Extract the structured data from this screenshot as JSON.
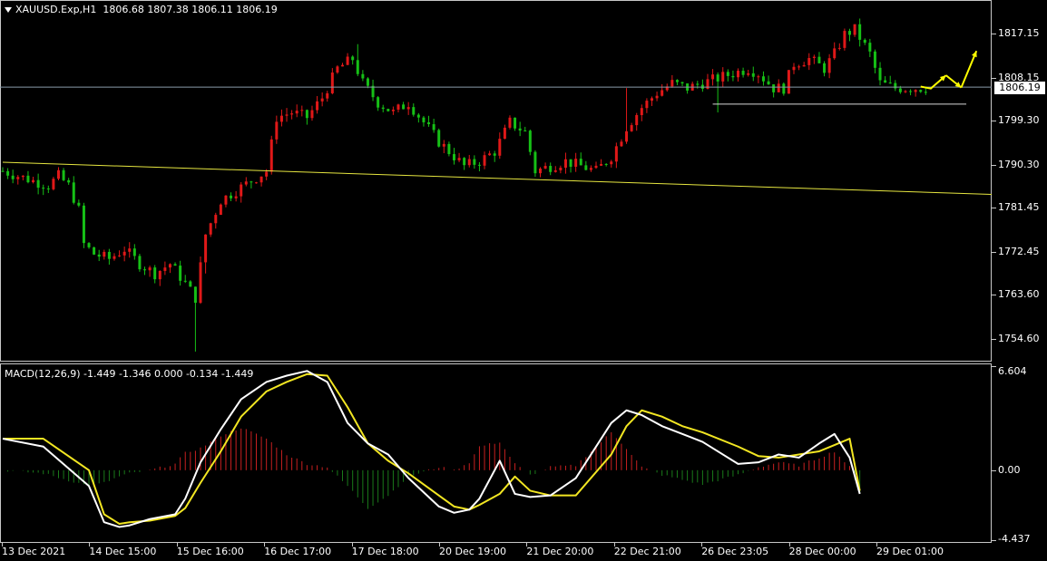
{
  "header": {
    "symbol": "XAUUSD.Exp,H1",
    "ohlc": "1806.68 1807.38 1806.11 1806.19",
    "macd_label": "MACD(12,26,9) -1.449 -1.346 0.000 -0.134 -1.449"
  },
  "current_price": "1806.19",
  "colors": {
    "background": "#000000",
    "bull": "#e01818",
    "bear": "#16c016",
    "trendline": "#e6e640",
    "macd_line": "#ffffff",
    "signal_line": "#f2e622",
    "histogram_pos": "#c82020",
    "histogram_neg": "#1a7a1a",
    "arrows": "#ffff00",
    "grid": "#c8c8c8"
  },
  "chart_data": [
    {
      "type": "candlestick",
      "title": "XAUUSD.Exp,H1",
      "ylim": [
        1750.5,
        1823.3
      ],
      "yticks": [
        "1817.15",
        "1808.15",
        "1799.30",
        "1790.30",
        "1781.45",
        "1772.45",
        "1763.60",
        "1754.60"
      ],
      "x_labels": [
        "13 Dec 2021",
        "14 Dec 15:00",
        "15 Dec 16:00",
        "16 Dec 17:00",
        "17 Dec 18:00",
        "20 Dec 19:00",
        "21 Dec 20:00",
        "22 Dec 21:00",
        "26 Dec 23:05",
        "28 Dec 00:00",
        "29 Dec 01:00"
      ],
      "price_path": [
        [
          0,
          1789
        ],
        [
          3,
          1788
        ],
        [
          6,
          1787
        ],
        [
          9,
          1786
        ],
        [
          11,
          1788
        ],
        [
          13,
          1786
        ],
        [
          15,
          1781
        ],
        [
          16,
          1774
        ],
        [
          18,
          1772
        ],
        [
          21,
          1771
        ],
        [
          24,
          1773
        ],
        [
          27,
          1770
        ],
        [
          30,
          1768
        ],
        [
          33,
          1770
        ],
        [
          36,
          1766
        ],
        [
          38,
          1763
        ],
        [
          40,
          1776
        ],
        [
          43,
          1783
        ],
        [
          46,
          1785
        ],
        [
          49,
          1787
        ],
        [
          52,
          1789
        ],
        [
          54,
          1800
        ],
        [
          57,
          1801
        ],
        [
          60,
          1800
        ],
        [
          63,
          1804
        ],
        [
          66,
          1810
        ],
        [
          69,
          1812
        ],
        [
          71,
          1807
        ],
        [
          74,
          1803
        ],
        [
          77,
          1801
        ],
        [
          80,
          1803
        ],
        [
          83,
          1799
        ],
        [
          86,
          1795
        ],
        [
          89,
          1792
        ],
        [
          91,
          1790
        ],
        [
          94,
          1791
        ],
        [
          97,
          1793
        ],
        [
          100,
          1799
        ],
        [
          103,
          1797
        ],
        [
          105,
          1789
        ],
        [
          108,
          1790
        ],
        [
          111,
          1791
        ],
        [
          114,
          1790
        ],
        [
          117,
          1789
        ],
        [
          120,
          1792
        ],
        [
          123,
          1798
        ],
        [
          126,
          1802
        ],
        [
          129,
          1805
        ],
        [
          132,
          1807
        ],
        [
          135,
          1806
        ],
        [
          138,
          1807
        ],
        [
          141,
          1808
        ],
        [
          144,
          1809
        ],
        [
          147,
          1810
        ],
        [
          149,
          1809
        ],
        [
          152,
          1806
        ],
        [
          154,
          1806
        ],
        [
          156,
          1811
        ],
        [
          159,
          1812
        ],
        [
          162,
          1810
        ],
        [
          164,
          1813
        ],
        [
          166,
          1817
        ],
        [
          168,
          1818
        ],
        [
          171,
          1813
        ],
        [
          173,
          1807
        ],
        [
          176,
          1806
        ],
        [
          179,
          1806
        ],
        [
          182,
          1806
        ]
      ],
      "long_wicks": [
        [
          38,
          1752
        ],
        [
          40,
          1768
        ],
        [
          70,
          1815
        ],
        [
          123,
          1806
        ],
        [
          141,
          1801
        ]
      ],
      "level_line": 1806.19,
      "support_line": [
        [
          140,
          1802.7
        ],
        [
          190,
          1802.7
        ]
      ],
      "trendline": [
        [
          0,
          1790.8
        ],
        [
          190,
          1784.2
        ]
      ],
      "projection_arrows": [
        [
          [
            181,
            1806.3
          ],
          [
            183,
            1805.9
          ],
          [
            186,
            1808.6
          ]
        ],
        [
          [
            186,
            1808.6
          ],
          [
            189,
            1806.1
          ]
        ],
        [
          [
            189,
            1806.1
          ],
          [
            192,
            1813.6
          ]
        ]
      ]
    },
    {
      "type": "line",
      "title": "MACD(12,26,9)",
      "ylim": [
        -4.437,
        6.604
      ],
      "yticks": [
        "6.604",
        "0.00",
        "-4.437"
      ],
      "x": [
        0,
        8,
        17,
        20,
        23,
        25,
        29,
        34,
        36,
        39,
        43,
        47,
        52,
        56,
        60,
        64,
        68,
        72,
        76,
        80,
        86,
        89,
        92,
        94,
        98,
        101,
        104,
        108,
        113,
        120,
        123,
        126,
        130,
        134,
        138,
        145,
        149,
        153,
        157,
        161,
        164,
        167,
        169
      ],
      "series": [
        {
          "name": "macd",
          "values": [
            2.0,
            1.5,
            -1.0,
            -3.3,
            -3.6,
            -3.5,
            -3.1,
            -2.8,
            -1.8,
            0.5,
            2.6,
            4.5,
            5.6,
            6.0,
            6.3,
            5.6,
            3.0,
            1.7,
            1.0,
            -0.5,
            -2.3,
            -2.7,
            -2.5,
            -1.8,
            0.6,
            -1.5,
            -1.7,
            -1.6,
            -0.5,
            3.0,
            3.8,
            3.5,
            2.8,
            2.3,
            1.8,
            0.4,
            0.5,
            1.0,
            0.8,
            1.7,
            2.3,
            0.8,
            -1.5
          ]
        },
        {
          "name": "signal",
          "values": [
            2.0,
            2.0,
            0.0,
            -2.8,
            -3.4,
            -3.3,
            -3.2,
            -2.9,
            -2.4,
            -0.8,
            1.2,
            3.4,
            5.0,
            5.6,
            6.1,
            6.0,
            4.0,
            1.7,
            0.6,
            -0.2,
            -1.6,
            -2.3,
            -2.5,
            -2.2,
            -1.5,
            -0.4,
            -1.3,
            -1.6,
            -1.6,
            1.0,
            2.8,
            3.8,
            3.4,
            2.8,
            2.4,
            1.5,
            0.9,
            0.8,
            1.0,
            1.2,
            1.6,
            2.0,
            -1.3
          ]
        },
        {
          "name": "histogram",
          "values": [
            0.0,
            -0.2,
            -1.0,
            -0.8,
            -0.4,
            -0.2,
            0.0,
            0.4,
            1.1,
            1.4,
            2.2,
            2.7,
            2.0,
            1.0,
            0.4,
            0.2,
            -1.0,
            -2.4,
            -1.6,
            -0.4,
            0.2,
            0.0,
            0.5,
            1.5,
            1.8,
            0.4,
            -0.3,
            0.2,
            0.3,
            2.4,
            1.4,
            0.2,
            -0.3,
            -0.6,
            -0.9,
            -0.3,
            0.2,
            0.5,
            0.3,
            0.8,
            1.2,
            0.2,
            -1.4
          ]
        }
      ]
    }
  ]
}
